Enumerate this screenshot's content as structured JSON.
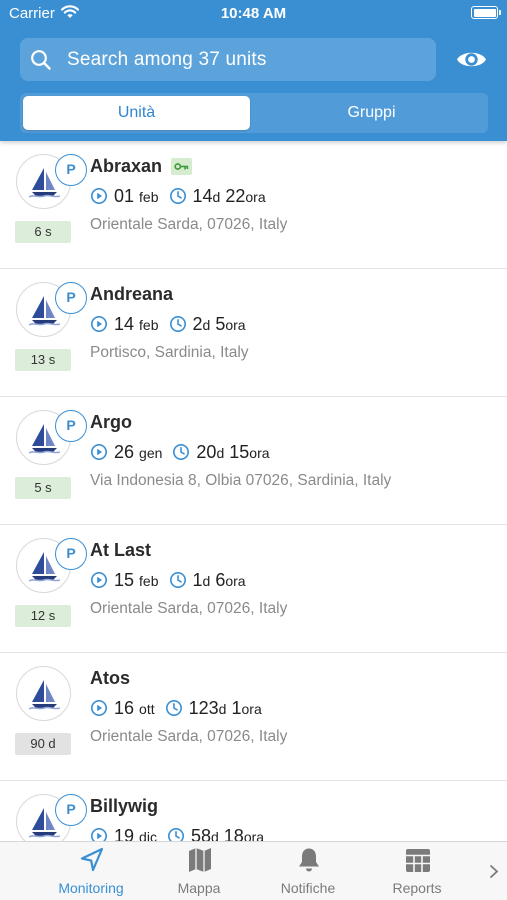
{
  "status_bar": {
    "carrier": "Carrier",
    "time": "10:48 AM"
  },
  "search": {
    "placeholder": "Search among 37 units"
  },
  "segments": [
    {
      "label": "Unità",
      "active": true
    },
    {
      "label": "Gruppi",
      "active": false
    }
  ],
  "colors": {
    "accent": "#3a8fd3",
    "age_fresh": "#dcedd9",
    "age_stale": "#e2e2e2",
    "key_badge": "#d6eccf"
  },
  "units": [
    {
      "name": "Abraxan",
      "parking": "P",
      "key_badge": true,
      "age": "6 s",
      "age_status": "fresh",
      "date_num": "01",
      "date_month": "feb",
      "dur_days": "14",
      "dur_days_unit": "d",
      "dur_hours": "22",
      "dur_hours_unit": "ora",
      "address": "Orientale Sarda,  07026, Italy"
    },
    {
      "name": "Andreana",
      "parking": "P",
      "key_badge": false,
      "age": "13 s",
      "age_status": "fresh",
      "date_num": "14",
      "date_month": "feb",
      "dur_days": "2",
      "dur_days_unit": "d",
      "dur_hours": "5",
      "dur_hours_unit": "ora",
      "address": "Portisco, Sardinia, Italy"
    },
    {
      "name": "Argo",
      "parking": "P",
      "key_badge": false,
      "age": "5 s",
      "age_status": "fresh",
      "date_num": "26",
      "date_month": "gen",
      "dur_days": "20",
      "dur_days_unit": "d",
      "dur_hours": "15",
      "dur_hours_unit": "ora",
      "address": "Via Indonesia 8, Olbia 07026, Sardinia, Italy"
    },
    {
      "name": "At Last",
      "parking": "P",
      "key_badge": false,
      "age": "12 s",
      "age_status": "fresh",
      "date_num": "15",
      "date_month": "feb",
      "dur_days": "1",
      "dur_days_unit": "d",
      "dur_hours": "6",
      "dur_hours_unit": "ora",
      "address": "Orientale Sarda,  07026, Italy"
    },
    {
      "name": "Atos",
      "parking": "",
      "key_badge": false,
      "age": "90 d",
      "age_status": "stale",
      "date_num": "16",
      "date_month": "ott",
      "dur_days": "123",
      "dur_days_unit": "d",
      "dur_hours": "1",
      "dur_hours_unit": "ora",
      "address": "Orientale Sarda,  07026, Italy"
    },
    {
      "name": "Billywig",
      "parking": "P",
      "key_badge": false,
      "age": "",
      "age_status": "fresh",
      "date_num": "19",
      "date_month": "dic",
      "dur_days": "58",
      "dur_days_unit": "d",
      "dur_hours": "18",
      "dur_hours_unit": "ora",
      "address": ""
    }
  ],
  "tabbar": {
    "items": [
      {
        "label": "Monitoring",
        "icon": "navigation-arrow-icon",
        "active": true
      },
      {
        "label": "Mappa",
        "icon": "map-icon",
        "active": false
      },
      {
        "label": "Notifiche",
        "icon": "bell-icon",
        "active": false
      },
      {
        "label": "Reports",
        "icon": "reports-table-icon",
        "active": false
      }
    ],
    "more_icon": "chevron-right-icon"
  }
}
